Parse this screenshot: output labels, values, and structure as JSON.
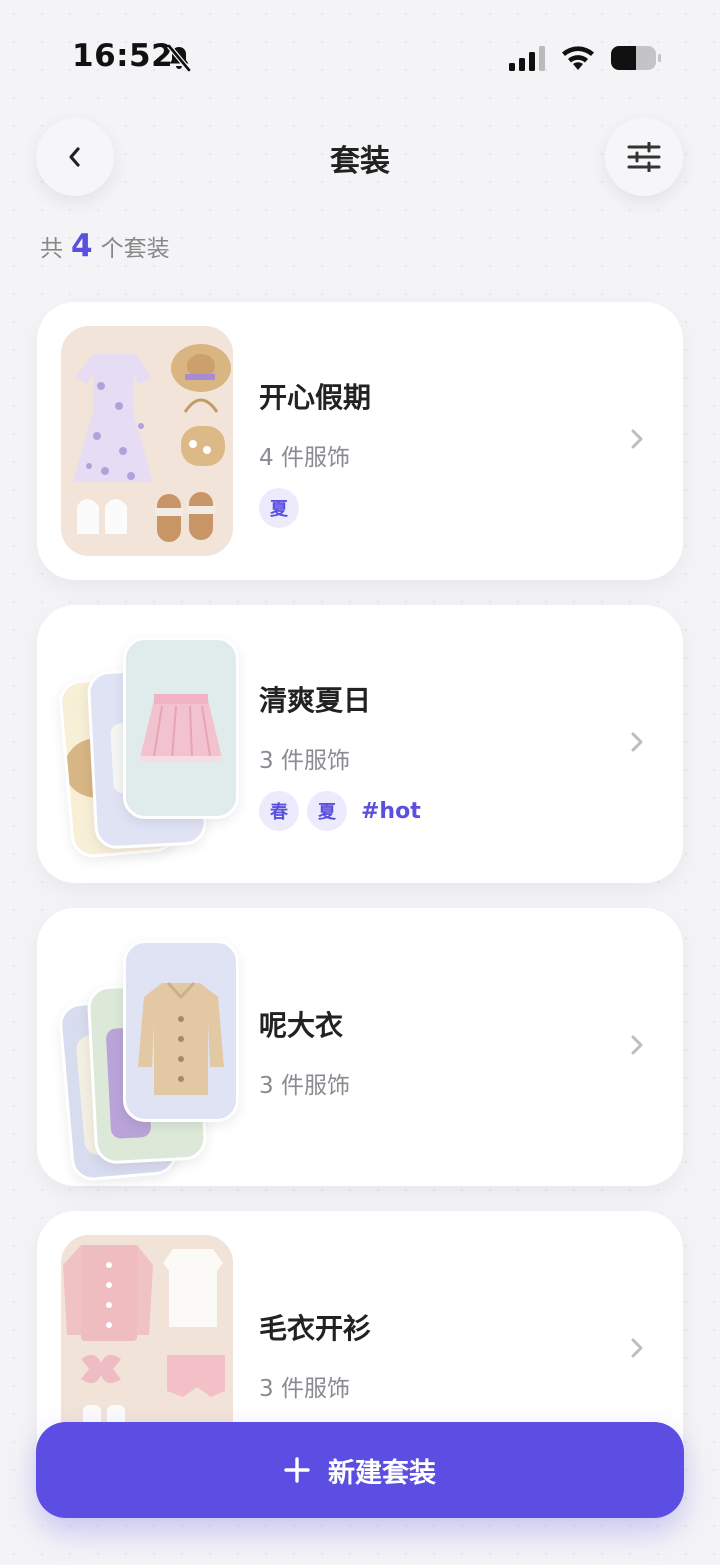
{
  "status_bar": {
    "time": "16:52"
  },
  "header": {
    "title": "套装"
  },
  "summary": {
    "prefix": "共",
    "count": "4",
    "suffix": "个套装"
  },
  "outfits": [
    {
      "name": "开心假期",
      "meta": "4 件服饰",
      "tags": [
        "夏"
      ]
    },
    {
      "name": "清爽夏日",
      "meta": "3 件服饰",
      "tags": [
        "春",
        "夏"
      ],
      "hashtag": "#hot"
    },
    {
      "name": "呢大衣",
      "meta": "3 件服饰",
      "tags": []
    },
    {
      "name": "毛衣开衫",
      "meta": "3 件服饰",
      "tags": []
    }
  ],
  "new_button": {
    "icon": "plus-icon",
    "label": "新建套装"
  },
  "colors": {
    "accent": "#5d4ee3",
    "tag_bg": "#ecebfb",
    "background": "#f4f4f7"
  }
}
